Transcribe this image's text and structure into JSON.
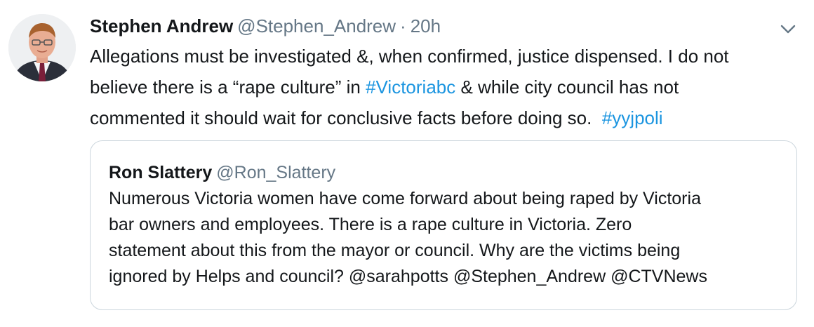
{
  "tweet": {
    "display_name": "Stephen Andrew",
    "handle": "@Stephen_Andrew",
    "separator": "·",
    "time": "20h",
    "text": {
      "line1": "Allegations must be investigated &, when confirmed,  justice dispensed.  I do not",
      "line2_before": "believe there is a “rape culture” in ",
      "line2_hashtag": "#Victoriabc",
      "line2_after": " & while city council has not",
      "line3_before": "commented it should wait for conclusive facts before doing so.  ",
      "line3_hashtag": "#yyjpoli"
    },
    "avatar_icon": "user-avatar-photo",
    "menu_icon": "chevron-down-icon"
  },
  "quoted_tweet": {
    "display_name": "Ron Slattery",
    "handle": "@Ron_Slattery",
    "lines": [
      "Numerous Victoria women have come forward about being raped by Victoria",
      "bar owners and employees. There is a rape culture in Victoria. Zero",
      "statement about this from the mayor or council. Why are the victims being",
      "ignored by Helps and council? @sarahpotts @Stephen_Andrew @CTVNews"
    ]
  },
  "colors": {
    "text": "#14171a",
    "secondary": "#657786",
    "link": "#1b95e0",
    "border": "#ccd6dd"
  }
}
